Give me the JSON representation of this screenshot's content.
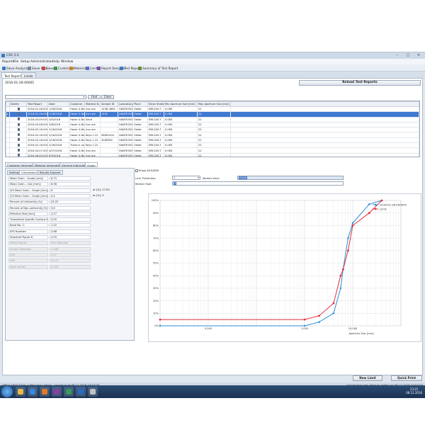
{
  "window": {
    "title": "CSA 3.4"
  },
  "menu": [
    "Reports",
    "File",
    "Setup",
    "Administration",
    "Help",
    "Window"
  ],
  "toolbar": [
    {
      "label": "Sieve Analysis",
      "color": "#3a78c4"
    },
    {
      "label": "Sieve Sets",
      "color": "#7a8a9c"
    },
    {
      "label": "Sieves",
      "color": "#c24a4a"
    },
    {
      "label": "Customers",
      "color": "#3b9a4b"
    },
    {
      "label": "Materials",
      "color": "#c78a2b"
    },
    {
      "label": "Limits",
      "color": "#5a6acb"
    },
    {
      "label": "Report Designer",
      "color": "#7a50b0"
    },
    {
      "label": "Test Report",
      "color": "#3a78c4"
    },
    {
      "label": "Summary of Test Report",
      "color": "#6a8a3c"
    }
  ],
  "doc_tabs": [
    "Test Report",
    "Limits"
  ],
  "report_id": "2016-01-28-00005",
  "reload_label": "Reload Test Reports",
  "find_label": "Find",
  "clear_label": "Clear",
  "grid": {
    "columns": [
      "Delete",
      "Test Report",
      "Date",
      "Customer ...",
      "Material N...",
      "Sample ID",
      "Laboratory",
      "Place",
      "Sieve Shaker",
      "Min Aperture Size [mm]",
      "Max Aperture Size [mm]"
    ],
    "rows": [
      [
        "",
        "2016-01-28-000...",
        "1/28/2016",
        "Haver & Bo...",
        "Iron ore",
        "1236-2805...",
        "HAVER BOE...",
        "Oelde",
        "EML200-T",
        "0.063",
        "22"
      ],
      [
        "",
        "2016-01-28-000...",
        "1/28/2016",
        "Haver & Bo...",
        "Iron ore",
        "1432",
        "HAVER BOE...",
        "Oelde",
        "EML200-T",
        "0.063",
        "22"
      ],
      [
        "",
        "2016-03-09-001...",
        "3/9/2016",
        "Haver & Bo...",
        "Sand",
        "",
        "HAVER BOE...",
        "Oelde",
        "EML200-T",
        "0.063",
        "22"
      ],
      [
        "",
        "2016-03-08-000...",
        "3/8/2016",
        "Haver & Bo...",
        "Iron ore",
        "",
        "HAVER BOE...",
        "Oelde",
        "EML200-T",
        "0.063",
        "22"
      ],
      [
        "",
        "2016-02-16-000...",
        "2/16/2016",
        "Haver & Bo...",
        "Iron ore",
        "",
        "HAVER BOE...",
        "Oelde",
        "EML200-T",
        "0.063",
        "22"
      ],
      [
        "",
        "2016-02-16-000...",
        "2/16/2016",
        "Haver & Bo...",
        "Keys 1.22",
        "56891441",
        "HAVER BOE...",
        "Oelde",
        "EML200-T",
        "0.063",
        "22"
      ],
      [
        "",
        "2016-02-16-000...",
        "2/16/2016",
        "Haver & Bo...",
        "Keys 1.22",
        "4589962",
        "HAVER BOE...",
        "Oelde",
        "EML200-T",
        "0.063",
        "22"
      ],
      [
        "",
        "2016-02-16-000...",
        "2/16/2016",
        "There is no ...",
        "Keys 1.22",
        "",
        "HAVER BOE...",
        "Oelde",
        "EML200-T",
        "0.063",
        "22"
      ],
      [
        "",
        "2016-04-27-001...",
        "4/27/2016",
        "Haver & Bo...",
        "Iron ore",
        "",
        "HAVER BOE...",
        "Oelde",
        "EML200-T",
        "0.063",
        "22"
      ],
      [
        "",
        "2016-06-09-000...",
        "6/9/2016",
        "Haver & Bo...",
        "Iron ore",
        "",
        "HAVER BOE...",
        "Oelde",
        "EML200-T",
        "0.063",
        "22"
      ]
    ],
    "selected_row": 1
  },
  "lower_tabs": [
    "Customer Information",
    "Material Information",
    "General Information",
    "Graph"
  ],
  "sub_tabs": [
    "Settings",
    "Calculations",
    "Results Explorer"
  ],
  "calc_rows": [
    {
      "label": "Mean Grain - Graph [mm]:",
      "value": "6.75",
      "extra": "",
      "disabled": false
    },
    {
      "label": "Mean Grain - Calc [mm]:",
      "value": "6.96",
      "extra": "",
      "disabled": false
    },
    {
      "label": "4/3 Mean Grain - Graph [mm]:",
      "value": "6",
      "extra": "at [%]: 27.83",
      "disabled": false
    },
    {
      "label": "2/3 Mean Grain - Graph [mm]:",
      "value": "4.5",
      "extra": "at [%]: 0",
      "disabled": false
    },
    {
      "label": "Percent of Uniformity [%]:",
      "value": "43.25",
      "extra": "",
      "disabled": false
    },
    {
      "label": "Percent of Non-uniformity [%]:",
      "value": "3.6",
      "extra": "",
      "disabled": false
    },
    {
      "label": "Effective Size [mm]:",
      "value": "2.07",
      "extra": "",
      "disabled": false
    },
    {
      "label": "Theoretical Specific Surface Area:",
      "value": "5.05",
      "extra": "",
      "disabled": false
    },
    {
      "label": "Bond No. C:",
      "value": "1.52",
      "extra": "",
      "disabled": false
    },
    {
      "label": "AFS Number:",
      "value": "2.88",
      "extra": "",
      "disabled": false
    },
    {
      "label": "Standard Figure K:",
      "value": "4.55",
      "extra": "",
      "disabled": false
    },
    {
      "label": "Model Values",
      "value": "Fein Meschke",
      "extra": "",
      "disabled": true
    },
    {
      "label": "Sauter Diameter:",
      "value": "1.166",
      "extra": "",
      "disabled": true
    },
    {
      "label": "D10",
      "value": "2.07",
      "extra": "",
      "disabled": true
    },
    {
      "label": "D90",
      "value": "20.41",
      "extra": "",
      "disabled": true
    },
    {
      "label": "Span Values",
      "value": "2.105",
      "extra": "",
      "disabled": true
    }
  ],
  "graph_controls": {
    "show_d_label": "Show D10/D90",
    "line_thickness_label": "Line Thickness:",
    "line_thickness_value": "1",
    "marker_kind_label": "Marker Kind:",
    "marker_kind_value": "Circle",
    "marker_size_label": "Marker Size:",
    "marker_size_value": "3"
  },
  "chart_data": {
    "type": "line",
    "xlabel": "Aperture Size [mm]",
    "xscale": "log",
    "xlim": [
      0.001,
      100
    ],
    "xticks": [
      "0.000",
      "1.000",
      "10.000"
    ],
    "ylim": [
      0,
      100
    ],
    "yticks": [
      "0%",
      "10%",
      "20%",
      "30%",
      "40%",
      "50%",
      "60%",
      "70%",
      "80%",
      "90%",
      "100%"
    ],
    "grid": true,
    "legend": "top-right",
    "series": [
      {
        "name": "2016-01-28-000005",
        "color": "#2a8fd8",
        "x": [
          0.001,
          1,
          2,
          4,
          5.6,
          6.3,
          8,
          10,
          22,
          40
        ],
        "y": [
          0,
          0,
          3,
          10,
          30,
          45,
          70,
          82,
          97,
          100
        ]
      },
      {
        "name": "Limit",
        "color": "#e0303c",
        "x": [
          0.001,
          1,
          2,
          4,
          5.6,
          6.3,
          8,
          10,
          22,
          40
        ],
        "y": [
          5,
          5,
          8,
          18,
          40,
          45,
          60,
          80,
          90,
          100
        ]
      }
    ]
  },
  "buttons": {
    "new_limit": "New Limit",
    "quick_print": "Quick Print"
  },
  "status": {
    "left": "Office 2007 Silver  •  Welcome: admin. Logged in at 08.12.2016 13:10:25",
    "right": "Last backup was done by admin on 08.12.2016 10:54:00"
  },
  "clock": {
    "time": "13:21",
    "date": "08.12.2016"
  },
  "taskbar_apps": [
    {
      "name": "explorer",
      "color": "#e8b84a"
    },
    {
      "name": "browser",
      "color": "#3d87d8"
    },
    {
      "name": "media",
      "color": "#e07a2a"
    },
    {
      "name": "onenote",
      "color": "#8a3fa8"
    },
    {
      "name": "csa",
      "color": "#3a9a5a"
    },
    {
      "name": "outlook",
      "color": "#2a6ac4"
    },
    {
      "name": "tool",
      "color": "#c2c2c2"
    }
  ]
}
